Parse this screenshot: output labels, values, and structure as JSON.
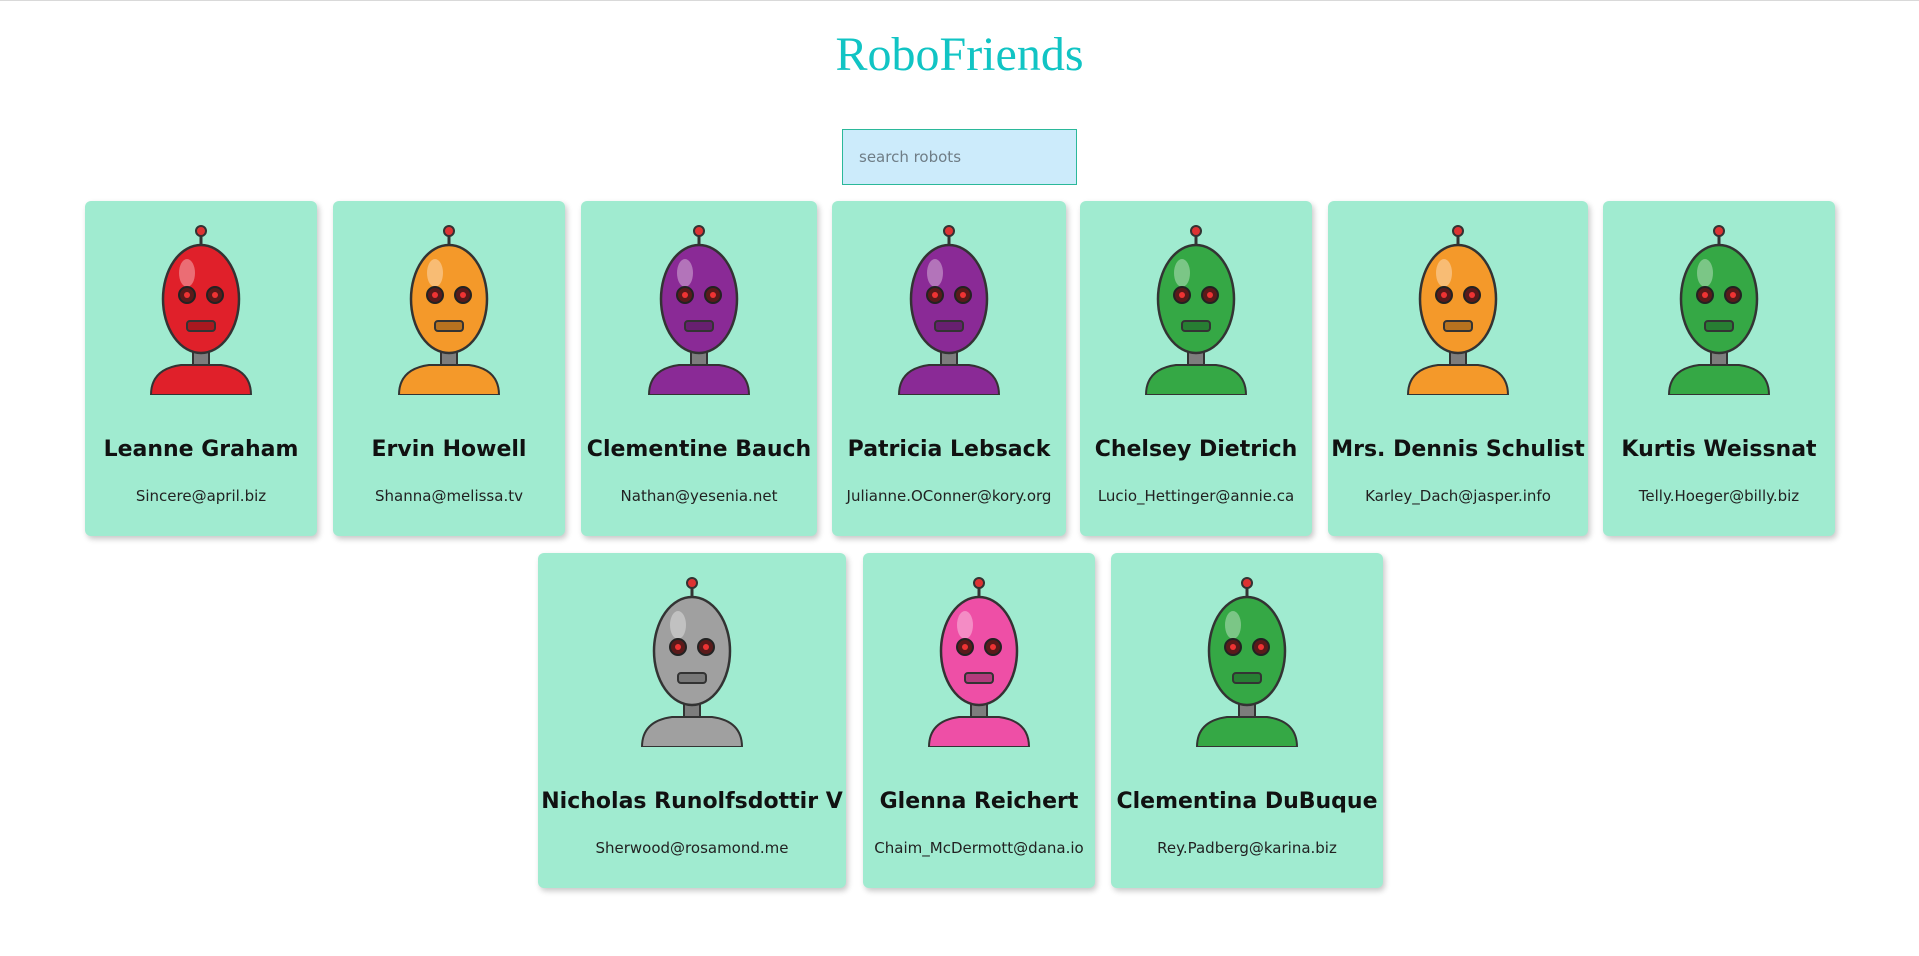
{
  "app": {
    "title": "RoboFriends"
  },
  "search": {
    "placeholder": "search robots",
    "value": ""
  },
  "robots": [
    {
      "name": "Leanne Graham",
      "email": "Sincere@april.biz",
      "color": "#e0202a"
    },
    {
      "name": "Ervin Howell",
      "email": "Shanna@melissa.tv",
      "color": "#f4992a"
    },
    {
      "name": "Clementine Bauch",
      "email": "Nathan@yesenia.net",
      "color": "#8a2a96"
    },
    {
      "name": "Patricia Lebsack",
      "email": "Julianne.OConner@kory.org",
      "color": "#8a2a96"
    },
    {
      "name": "Chelsey Dietrich",
      "email": "Lucio_Hettinger@annie.ca",
      "color": "#35a845"
    },
    {
      "name": "Mrs. Dennis Schulist",
      "email": "Karley_Dach@jasper.info",
      "color": "#f4992a"
    },
    {
      "name": "Kurtis Weissnat",
      "email": "Telly.Hoeger@billy.biz",
      "color": "#35a845"
    },
    {
      "name": "Nicholas Runolfsdottir V",
      "email": "Sherwood@rosamond.me",
      "color": "#a0a0a0"
    },
    {
      "name": "Glenna Reichert",
      "email": "Chaim_McDermott@dana.io",
      "color": "#ee4fa6"
    },
    {
      "name": "Clementina DuBuque",
      "email": "Rey.Padberg@karina.biz",
      "color": "#35a845"
    }
  ]
}
